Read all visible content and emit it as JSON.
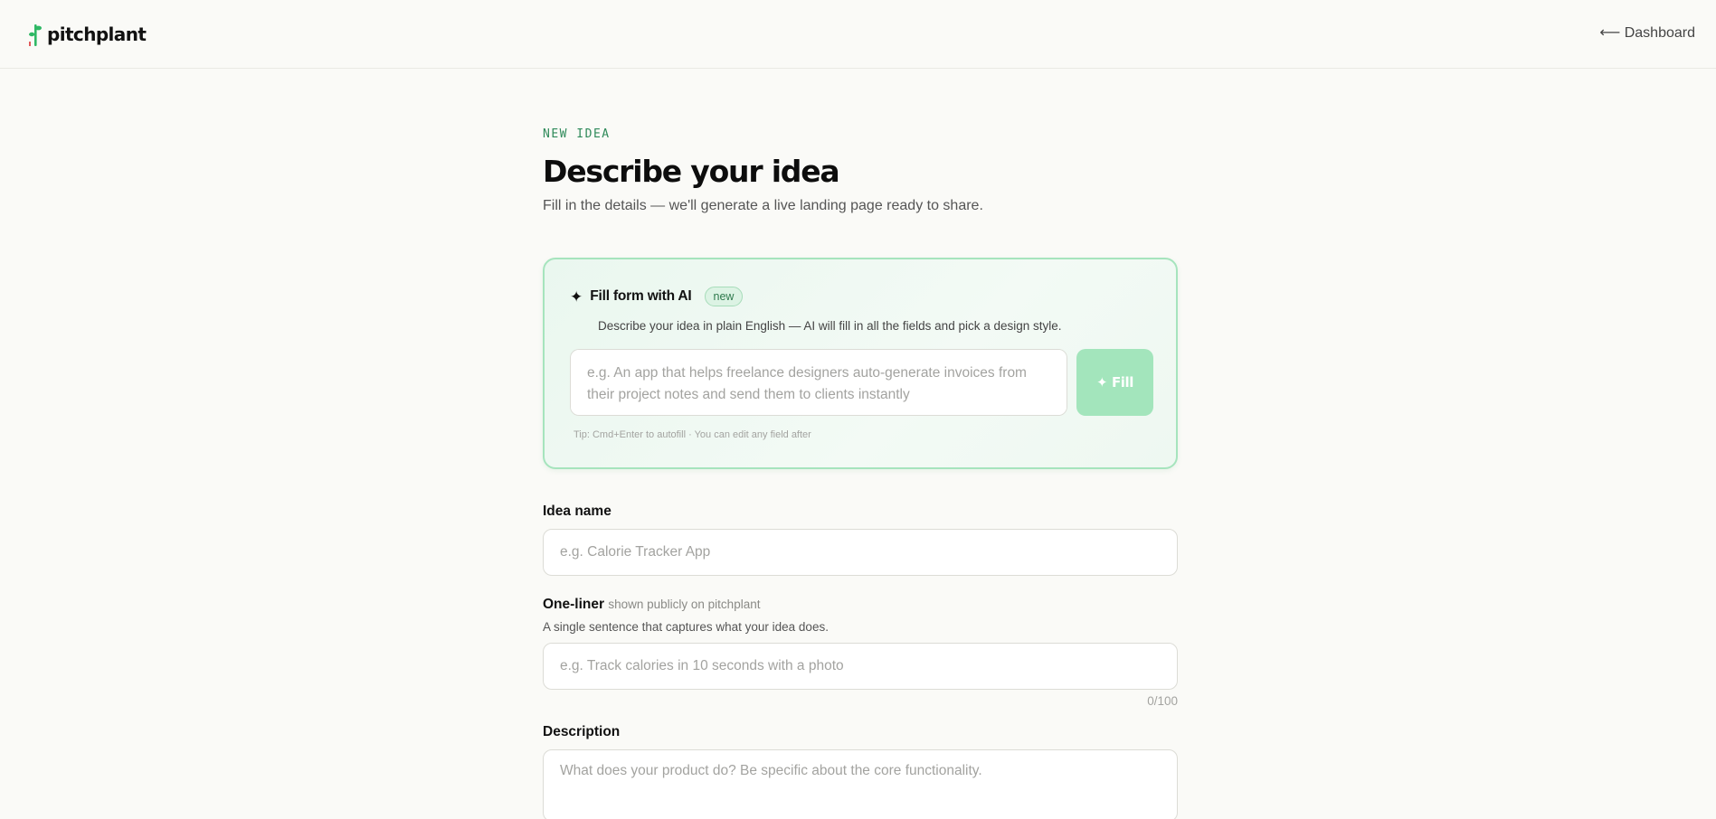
{
  "header": {
    "logo_text": "pitchplant",
    "dashboard_link": "⟵ Dashboard",
    "accent_color": "#2fb865"
  },
  "intro": {
    "eyebrow": "NEW IDEA",
    "title": "Describe your idea",
    "subtitle": "Fill in the details — we'll generate a live landing page ready to share."
  },
  "ai_fill": {
    "icon": "sparkle-icon",
    "title": "Fill form with AI",
    "badge": "new",
    "description": "Describe your idea in plain English — AI will fill in all the fields and pick a design style.",
    "placeholder": "e.g. An app that helps freelance designers auto-generate invoices from their project notes and send them to clients instantly",
    "button_label": "✦ Fill",
    "tip": "Tip: Cmd+Enter to autofill · You can edit any field after"
  },
  "form": {
    "idea_name": {
      "label": "Idea name",
      "placeholder": "e.g. Calorie Tracker App"
    },
    "one_liner": {
      "label": "One-liner",
      "note": "shown publicly on pitchplant",
      "help": "A single sentence that captures what your idea does.",
      "placeholder": "e.g. Track calories in 10 seconds with a photo",
      "counter": "0/100"
    },
    "description": {
      "label": "Description",
      "placeholder": "What does your product do? Be specific about the core functionality."
    }
  }
}
